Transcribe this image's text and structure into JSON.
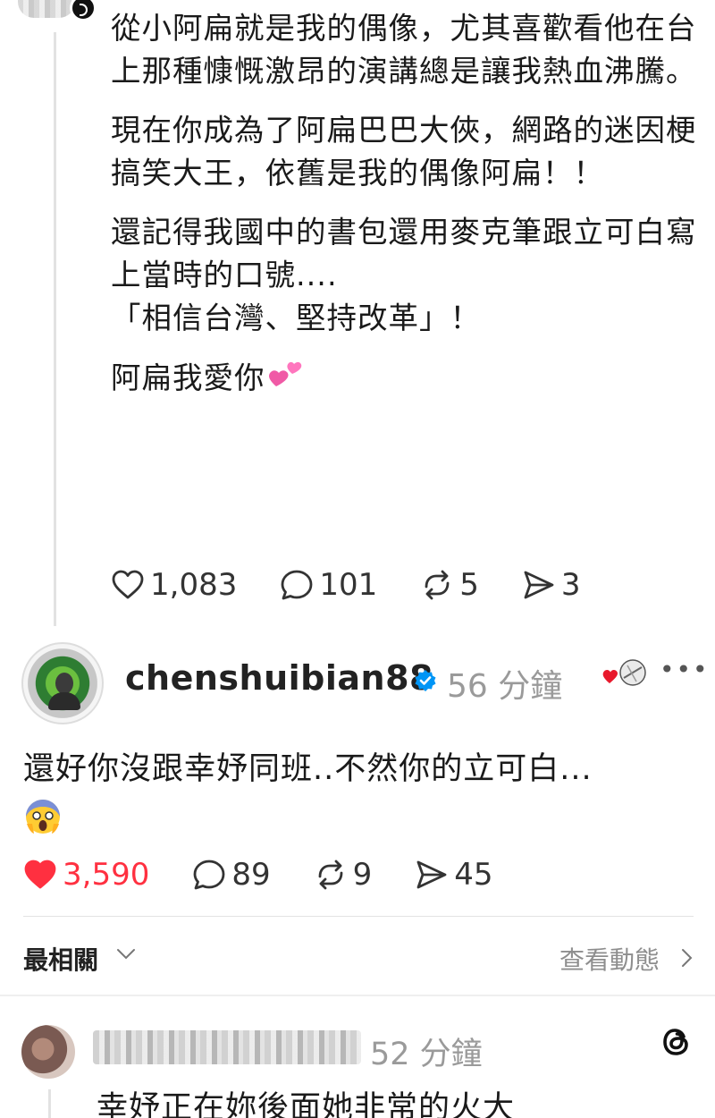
{
  "parent_comment": {
    "paragraphs": [
      "從小阿扁就是我的偶像，尤其喜歡看他在台上那種慷慨激昂的演講總是讓我熱血沸騰。",
      "現在你成為了阿扁巴巴大俠，網路的迷因梗搞笑大王，依舊是我的偶像阿扁！！",
      "還記得我國中的書包還用麥克筆跟立可白寫上當時的口號....\n「相信台灣、堅持改革」！",
      "阿扁我愛你"
    ],
    "closing_emoji": "two-hearts-emoji",
    "stats": {
      "likes": "1,083",
      "replies": "101",
      "reposts": "5",
      "shares": "3"
    }
  },
  "post": {
    "username": "chenshuibian88",
    "verified": true,
    "time_ago": "56 分鐘",
    "text": "還好你沒跟幸妤同班..不然你的立可白...",
    "emoji": "screaming-face-emoji",
    "liked_by_author_icon": "heart-with-avatar-icon",
    "stats": {
      "likes": "3,590",
      "replies": "89",
      "reposts": "9",
      "shares": "45"
    },
    "liked": true
  },
  "sort": {
    "label": "最相關",
    "activity_link": "查看動態"
  },
  "next_reply": {
    "time_ago": "52 分鐘",
    "text": "幸妤正在妳後面她非常的火大"
  },
  "colors": {
    "like_active": "#ff3040",
    "verified_blue": "#0095f6",
    "muted": "#9a9a9a"
  }
}
